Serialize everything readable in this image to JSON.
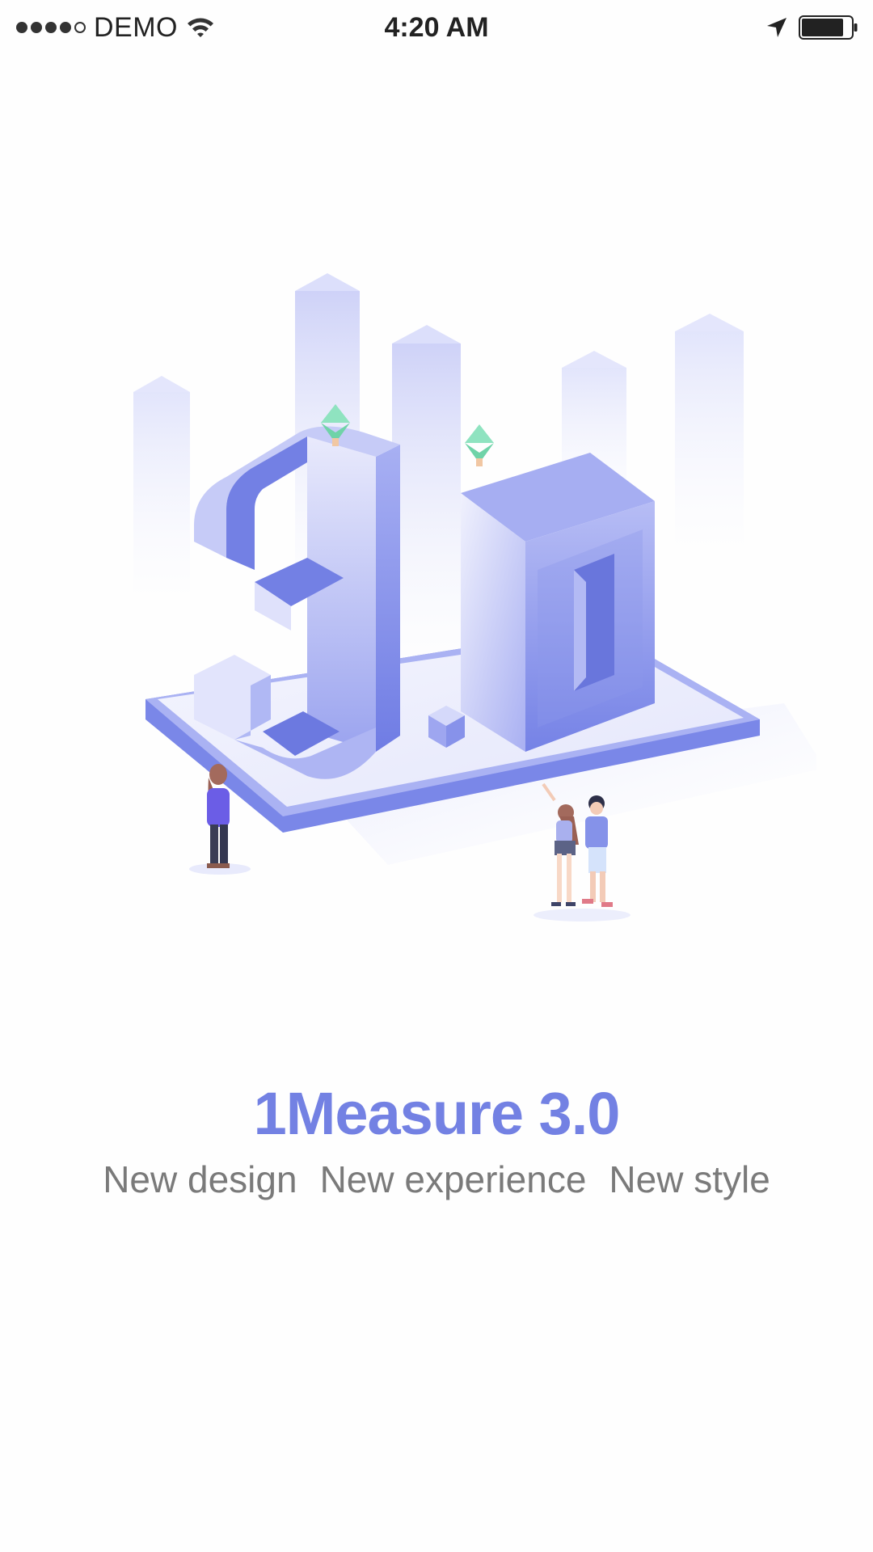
{
  "status_bar": {
    "carrier": "DEMO",
    "time": "4:20 AM",
    "signal_strength": 4,
    "signal_max": 5,
    "icons": [
      "wifi-icon",
      "location-arrow-icon",
      "battery-icon"
    ],
    "battery_level": 0.85
  },
  "illustration": {
    "subject": "3.0",
    "icon_name": "isometric-3d-illustration"
  },
  "intro": {
    "title": "1Measure 3.0",
    "taglines": [
      "New design",
      "New experience",
      "New style"
    ]
  },
  "colors": {
    "accent": "#7381e3",
    "tagline": "#7a7a7a",
    "background": "#fefefe"
  }
}
